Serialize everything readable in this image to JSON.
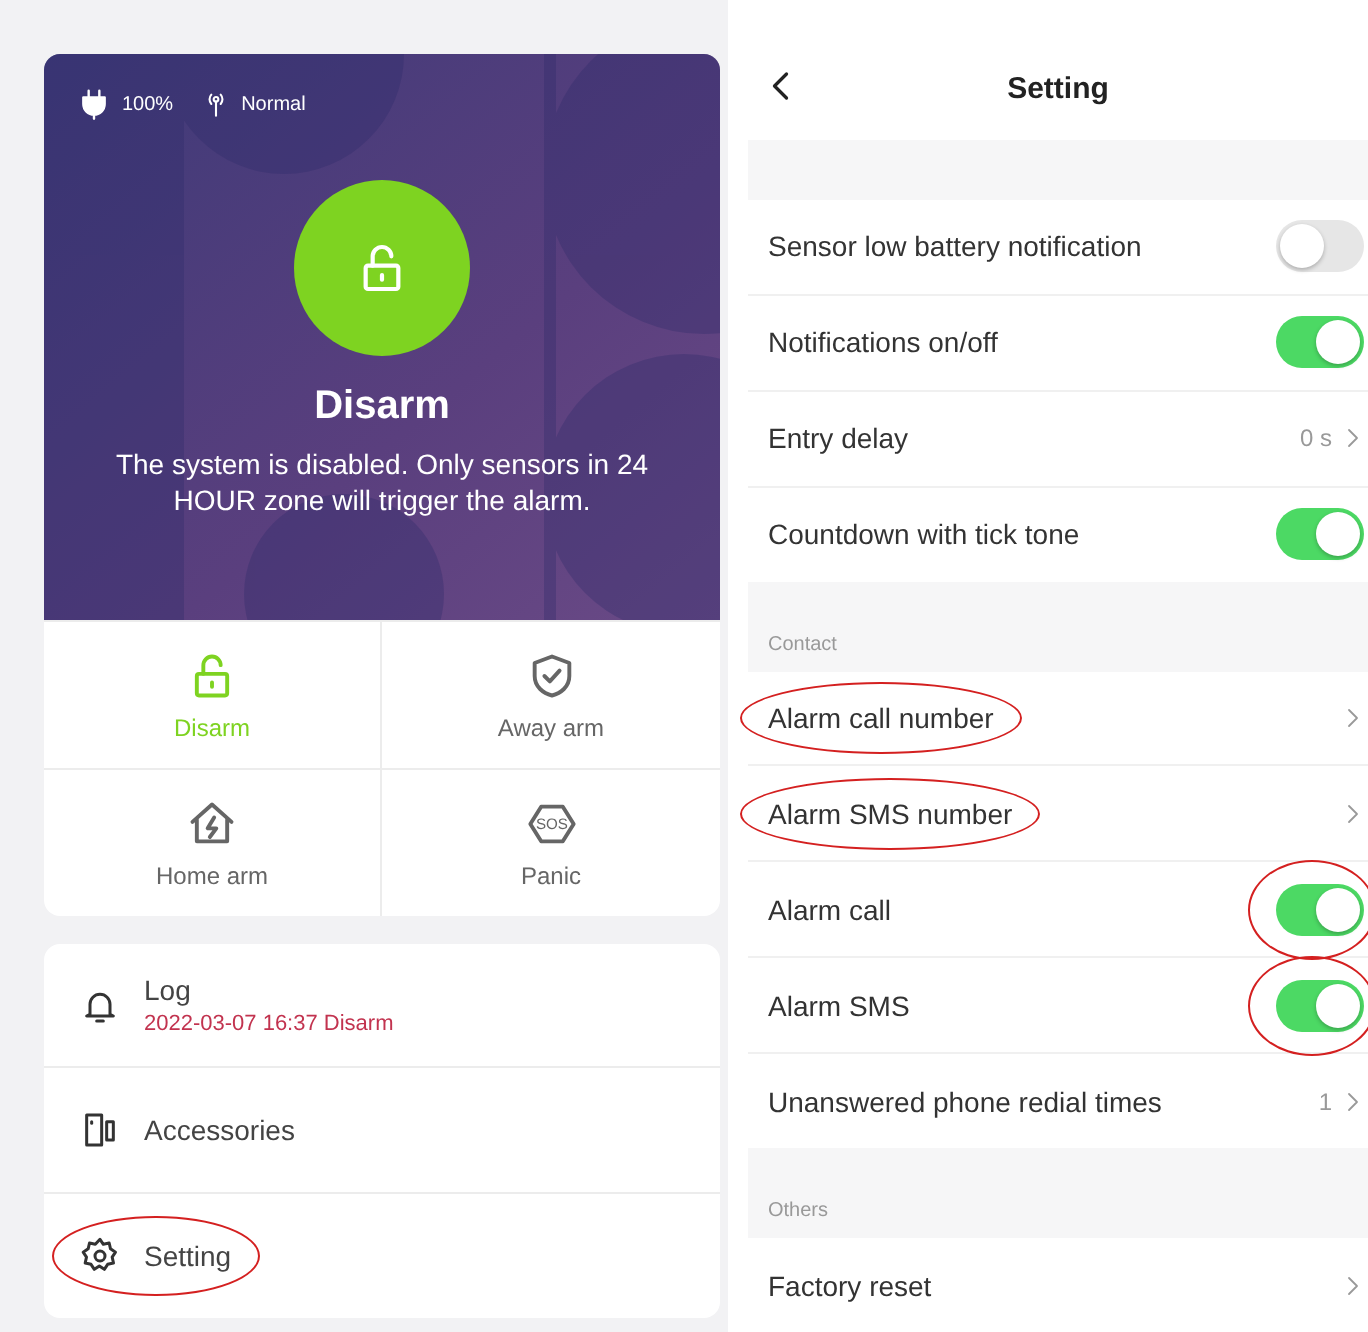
{
  "status_bar": {
    "power": "100%",
    "signal": "Normal"
  },
  "status": {
    "title": "Disarm",
    "description": "The system is disabled. Only sensors in 24 HOUR zone will trigger the alarm."
  },
  "modes": [
    {
      "kind": "disarm",
      "label": "Disarm",
      "selected": true
    },
    {
      "kind": "away",
      "label": "Away arm",
      "selected": false
    },
    {
      "kind": "home",
      "label": "Home arm",
      "selected": false
    },
    {
      "kind": "panic",
      "label": "Panic",
      "selected": false
    }
  ],
  "panic_icon_text": "SOS",
  "menu": [
    {
      "kind": "log",
      "label": "Log",
      "detail": "2022-03-07 16:37 Disarm",
      "circled": false
    },
    {
      "kind": "accessories",
      "label": "Accessories",
      "circled": false
    },
    {
      "kind": "setting",
      "label": "Setting",
      "circled": true
    }
  ],
  "setting": {
    "title": "Setting",
    "sections": [
      {
        "items": [
          {
            "kind": "toggle",
            "label": "Sensor low battery notification",
            "on": false,
            "circled": false
          },
          {
            "kind": "toggle",
            "label": "Notifications on/off",
            "on": true,
            "circled": false
          },
          {
            "kind": "link",
            "label": "Entry delay",
            "value": "0 s",
            "circled": false
          },
          {
            "kind": "toggle",
            "label": "Countdown with tick tone",
            "on": true,
            "circled": false
          }
        ]
      },
      {
        "header": "Contact",
        "items": [
          {
            "kind": "link",
            "label": "Alarm call number",
            "circled": true
          },
          {
            "kind": "link",
            "label": "Alarm SMS number",
            "circled": true
          },
          {
            "kind": "toggle",
            "label": "Alarm call",
            "on": true,
            "circled": true
          },
          {
            "kind": "toggle",
            "label": "Alarm SMS",
            "on": true,
            "circled": true
          },
          {
            "kind": "link",
            "label": "Unanswered phone redial times",
            "value": "1",
            "circled": false
          }
        ]
      },
      {
        "header": "Others",
        "items": [
          {
            "kind": "link",
            "label": "Factory reset",
            "circled": false
          }
        ]
      }
    ]
  }
}
